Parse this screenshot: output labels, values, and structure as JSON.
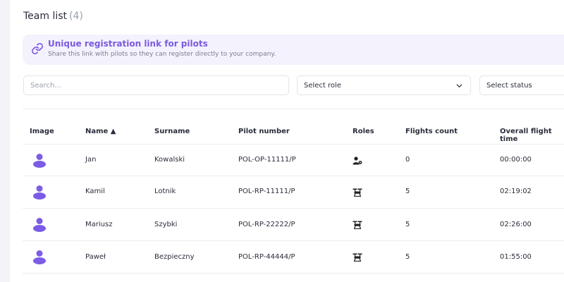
{
  "header": {
    "title": "Team list",
    "count": "(4)"
  },
  "banner": {
    "icon": "link-icon",
    "title": "Unique registration link for pilots",
    "subtitle": "Share this link with pilots so they can register directly to your company."
  },
  "filters": {
    "search_placeholder": "Search...",
    "role_label": "Select role",
    "status_label": "Select status"
  },
  "table": {
    "columns": [
      "Image",
      "Name ▲",
      "Surname",
      "Pilot number",
      "Roles",
      "Flights count",
      "Overall flight time"
    ],
    "rows": [
      {
        "avatar_icon": "user-avatar-icon",
        "name": "Jan",
        "surname": "Kowalski",
        "pilot_number": "POL-OP-11111/P",
        "role_icon": "operator-role-icon",
        "flights": "0",
        "time": "00:00:00"
      },
      {
        "avatar_icon": "user-avatar-icon",
        "name": "Kamil",
        "surname": "Lotnik",
        "pilot_number": "POL-RP-11111/P",
        "role_icon": "drone-pilot-role-icon",
        "flights": "5",
        "time": "02:19:02"
      },
      {
        "avatar_icon": "user-avatar-icon",
        "name": "Mariusz",
        "surname": "Szybki",
        "pilot_number": "POL-RP-22222/P",
        "role_icon": "drone-pilot-role-icon",
        "flights": "5",
        "time": "02:26:00"
      },
      {
        "avatar_icon": "user-avatar-icon",
        "name": "Paweł",
        "surname": "Bezpieczny",
        "pilot_number": "POL-RP-44444/P",
        "role_icon": "drone-pilot-role-icon",
        "flights": "5",
        "time": "01:55:00"
      }
    ]
  },
  "colors": {
    "accent": "#7b5ae0",
    "avatar": "#7c5ce6",
    "banner_bg": "#f4f2fd"
  }
}
